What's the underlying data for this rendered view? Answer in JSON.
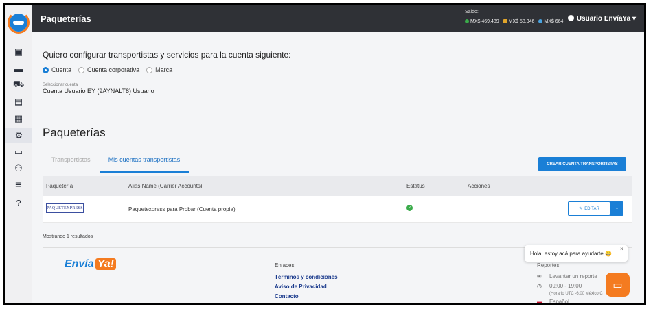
{
  "header": {
    "title": "Paqueterías",
    "saldo_label": "Saldo:",
    "balances": [
      {
        "value": "MX$ 469,489",
        "icon": "dollar-icon",
        "color": "#3aab4a"
      },
      {
        "value": "MX$ 58,346",
        "icon": "flag-icon",
        "color": "#e2a52a"
      },
      {
        "value": "MX$ 664",
        "icon": "globe-icon",
        "color": "#4aa3df"
      }
    ],
    "user": "Usuario EnvíaYa",
    "user_caret": "▾"
  },
  "sidebar": {
    "items": [
      {
        "icon": "dashboard-icon",
        "glyph": "▣"
      },
      {
        "icon": "store-icon",
        "glyph": "▬"
      },
      {
        "icon": "truck-icon",
        "glyph": "⛟"
      },
      {
        "icon": "document-icon",
        "glyph": "▤"
      },
      {
        "icon": "contacts-icon",
        "glyph": "▦"
      },
      {
        "icon": "settings-icon",
        "glyph": "⚙"
      },
      {
        "icon": "dev-icon",
        "glyph": "▭"
      },
      {
        "icon": "users-icon",
        "glyph": "⚇"
      },
      {
        "icon": "stack-icon",
        "glyph": "≣"
      },
      {
        "icon": "help-icon",
        "glyph": "?"
      }
    ]
  },
  "main": {
    "heading": "Quiero configurar transportistas y servicios para la cuenta siguiente:",
    "radios": [
      {
        "label": "Cuenta",
        "selected": true
      },
      {
        "label": "Cuenta corporativa",
        "selected": false
      },
      {
        "label": "Marca",
        "selected": false
      }
    ],
    "select_label": "Seleccionar cuenta",
    "select_value": "Cuenta Usuario EY (9AYNALT8) Usuario E",
    "section_title": "Paqueterías",
    "tabs": [
      {
        "label": "Transportistas",
        "active": false
      },
      {
        "label": "Mis cuentas transportistas",
        "active": true
      }
    ],
    "create_button": "CREAR CUENTA TRANSPORTISTAS",
    "table": {
      "headers": [
        "Paquetería",
        "Alias Name (Carrier Accounts)",
        "Estatus",
        "Acciones"
      ],
      "rows": [
        {
          "carrier_logo": "PAQUETEXPRESS",
          "alias": "Paquetexpress para Probar (Cuenta propia)",
          "status": "active"
        }
      ],
      "edit_label": "EDITAR",
      "caret": "▾"
    },
    "showing": "Mostrando 1 resultados"
  },
  "footer": {
    "brand": "Envía",
    "brand_ya": "Ya!",
    "links_title": "Enlaces",
    "links": [
      "Términos y condiciones",
      "Aviso de Privacidad",
      "Contacto"
    ],
    "reportes_title": "Reportes",
    "report_items": [
      {
        "icon": "mail-icon",
        "glyph": "✉",
        "text": "Levantar un reporte"
      },
      {
        "icon": "clock-icon",
        "glyph": "◷",
        "text": "09:00 - 19:00"
      },
      {
        "icon": "",
        "glyph": "",
        "text": "(Horario UTC -6:00 México C"
      },
      {
        "icon": "spain-flag-icon",
        "glyph": "▬",
        "text": "Español"
      }
    ]
  },
  "chat": {
    "bubble_text": "Hola! estoy acá para ayudarte 😀",
    "close": "×"
  }
}
